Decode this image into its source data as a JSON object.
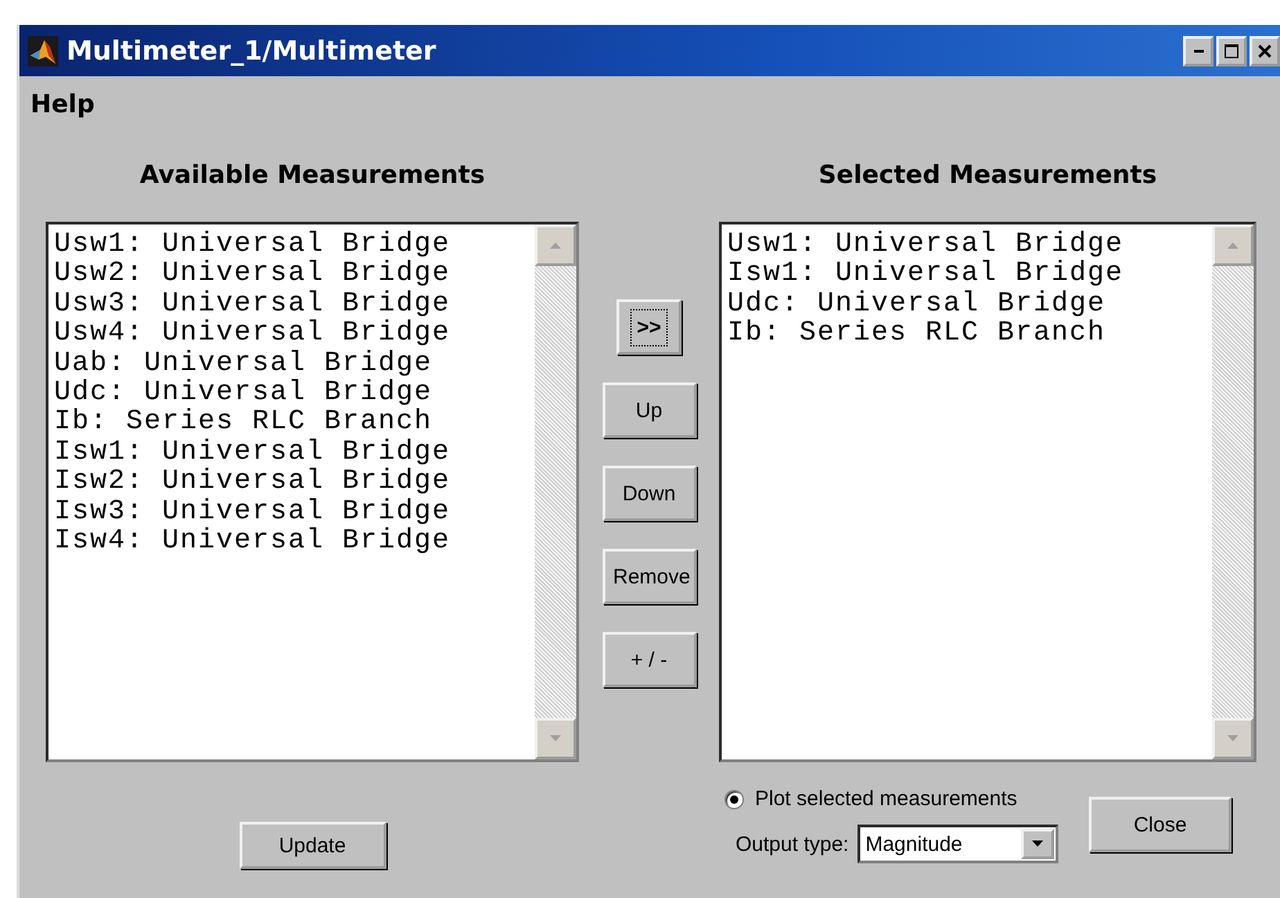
{
  "window": {
    "title": "Multimeter_1/Multimeter"
  },
  "menu": [
    "Help"
  ],
  "available": {
    "heading": "Available Measurements",
    "items": [
      "Usw1: Universal Bridge",
      "Usw2: Universal Bridge",
      "Usw3: Universal Bridge",
      "Usw4: Universal Bridge",
      "Uab: Universal Bridge",
      "Udc: Universal Bridge",
      "Ib: Series RLC Branch",
      "Isw1: Universal Bridge",
      "Isw2: Universal Bridge",
      "Isw3: Universal Bridge",
      "Isw4: Universal Bridge"
    ]
  },
  "transfer_buttons": [
    {
      "label": ">>",
      "focused": true
    },
    {
      "label": "Up",
      "focused": false
    },
    {
      "label": "Down",
      "focused": false
    },
    {
      "label": "Remove",
      "focused": false
    },
    {
      "label": "+ / -",
      "focused": false
    }
  ],
  "selected": {
    "heading": "Selected Measurements",
    "items": [
      "Usw1: Universal Bridge",
      "Isw1: Universal Bridge",
      "Udc: Universal Bridge",
      "Ib: Series RLC Branch"
    ]
  },
  "update_button": "Update",
  "plot_option": {
    "label": "Plot selected measurements",
    "selected": true
  },
  "output_type": {
    "label": "Output type:",
    "value": "Magnitude"
  },
  "close_button": "Close"
}
